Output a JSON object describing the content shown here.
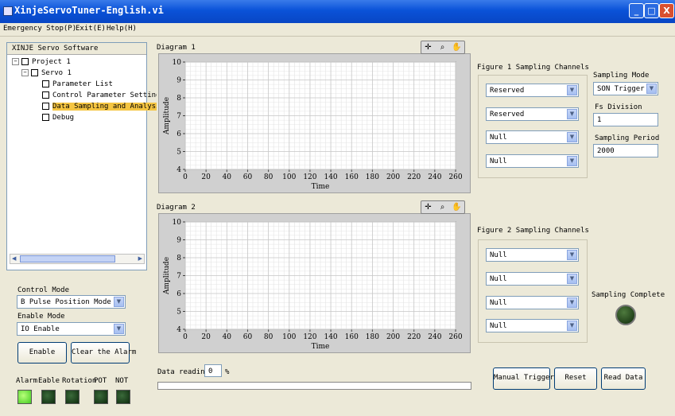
{
  "window": {
    "title": "XinjeServoTuner-English.vi",
    "min_glyph": "_",
    "max_glyph": "□",
    "close_glyph": "X"
  },
  "menu": {
    "items": [
      "Emergency Stop(P)",
      "Exit(E)",
      "Help(H)"
    ]
  },
  "tree": {
    "header": "XINJE Servo Software",
    "nodes": [
      {
        "label": "Project 1"
      },
      {
        "label": "Servo 1"
      },
      {
        "label": "Parameter List"
      },
      {
        "label": "Control Parameter Setting"
      },
      {
        "label": "Data Sampling and Analysis"
      },
      {
        "label": "Debug"
      }
    ],
    "selected_index": 4
  },
  "controls": {
    "control_mode_label": "Control Mode",
    "control_mode_value": "B Pulse Position Mode",
    "enable_mode_label": "Enable Mode",
    "enable_mode_value": "IO Enable",
    "enable_button": "Enable",
    "clear_alarm_button": "Clear the Alarm"
  },
  "indicators": [
    {
      "label": "Alarm",
      "state": "on"
    },
    {
      "label": "Eable",
      "state": "off"
    },
    {
      "label": "Rotation",
      "state": "off"
    },
    {
      "label": "POT",
      "state": "off"
    },
    {
      "label": "NOT",
      "state": "off"
    }
  ],
  "diagrams": [
    {
      "title": "Diagram 1"
    },
    {
      "title": "Diagram 2"
    }
  ],
  "chart_data": [
    {
      "type": "line",
      "title": "Diagram 1",
      "xlabel": "Time",
      "ylabel": "Amplitude",
      "xlim": [
        0,
        260
      ],
      "ylim": [
        4,
        10
      ],
      "xticks": [
        0,
        20,
        40,
        60,
        80,
        100,
        120,
        140,
        160,
        180,
        200,
        220,
        240,
        260
      ],
      "yticks": [
        4,
        5,
        6,
        7,
        8,
        9,
        10
      ],
      "grid": true,
      "series": []
    },
    {
      "type": "line",
      "title": "Diagram 2",
      "xlabel": "Time",
      "ylabel": "Amplitude",
      "xlim": [
        0,
        260
      ],
      "ylim": [
        4,
        10
      ],
      "xticks": [
        0,
        20,
        40,
        60,
        80,
        100,
        120,
        140,
        160,
        180,
        200,
        220,
        240,
        260
      ],
      "yticks": [
        4,
        5,
        6,
        7,
        8,
        9,
        10
      ],
      "grid": true,
      "series": []
    }
  ],
  "figure1": {
    "label": "Figure 1 Sampling Channels",
    "channels": [
      "Reserved",
      "Reserved",
      "Null",
      "Null"
    ]
  },
  "figure2": {
    "label": "Figure 2 Sampling Channels",
    "channels": [
      "Null",
      "Null",
      "Null",
      "Null"
    ]
  },
  "sampling": {
    "mode_label": "Sampling Mode",
    "mode_value": "SON Trigger",
    "division_label": "Fs Division",
    "division_value": "1",
    "period_label": "Sampling Period",
    "period_value": "2000",
    "complete_label": "Sampling Complete"
  },
  "data_reading": {
    "label": "Data reading",
    "value": "0",
    "unit": "%",
    "progress": 0
  },
  "actions": {
    "manual_trigger": "Manual Trigger",
    "reset": "Reset",
    "read_data": "Read Data"
  },
  "icons": {
    "combo_arrow": "▼",
    "tree_expand": "−",
    "scroll_left": "◀",
    "scroll_right": "▶"
  },
  "colors": {
    "title_bar": "#0a52d8",
    "selected_node": "#f5c542",
    "led_on": "#44cc22",
    "led_off": "#0e2a0e"
  }
}
